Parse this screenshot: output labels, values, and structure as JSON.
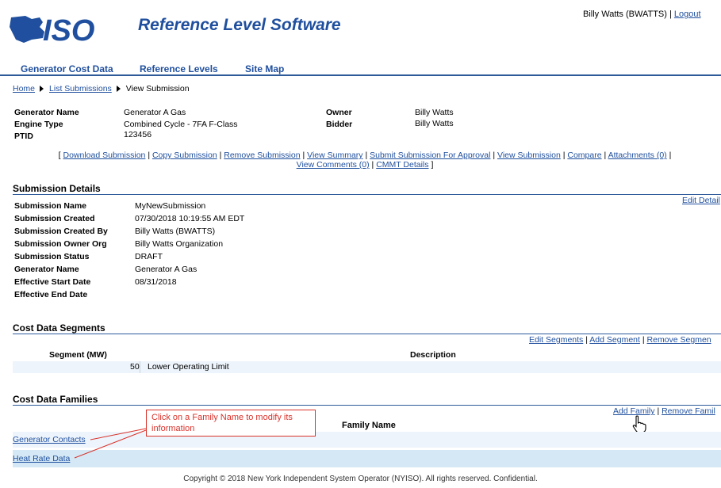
{
  "header": {
    "logo_text": "ISO",
    "app_title": "Reference Level Software",
    "user": "Billy Watts (BWATTS)",
    "separator": "|",
    "logout": "Logout"
  },
  "nav": {
    "items": [
      "Generator Cost Data",
      "Reference Levels",
      "Site Map"
    ]
  },
  "breadcrumb": {
    "home": "Home",
    "list": "List Submissions",
    "current": "View Submission"
  },
  "generator": {
    "name_label": "Generator Name",
    "name": "Generator A Gas",
    "engine_label": "Engine Type",
    "engine": "Combined Cycle - 7FA F-Class",
    "ptid_label": "PTID",
    "ptid": "123456",
    "owner_label": "Owner",
    "owner": "Billy Watts",
    "bidder_label": "Bidder",
    "bidder": "Billy Watts"
  },
  "actions": {
    "open": "[",
    "close": "]",
    "sep": "|",
    "download": "Download Submission",
    "copy": "Copy Submission",
    "remove": "Remove Submission",
    "view_summary": "View Summary",
    "submit": "Submit Submission For Approval",
    "view_submission": "View Submission",
    "compare": "Compare",
    "attachments": "Attachments (0)",
    "view_comments": "View Comments (0)",
    "cmmt": "CMMT Details"
  },
  "submission": {
    "title": "Submission Details",
    "edit": "Edit Detail",
    "fields": [
      {
        "label": "Submission Name",
        "value": "MyNewSubmission"
      },
      {
        "label": "Submission Created",
        "value": "07/30/2018 10:19:55 AM EDT"
      },
      {
        "label": "Submission Created By",
        "value": "Billy Watts (BWATTS)"
      },
      {
        "label": "Submission Owner Org",
        "value": "Billy Watts Organization"
      },
      {
        "label": "Submission Status",
        "value": "DRAFT"
      },
      {
        "label": "Generator Name",
        "value": "Generator A Gas"
      },
      {
        "label": "Effective Start Date",
        "value": "08/31/2018"
      },
      {
        "label": "Effective End Date",
        "value": ""
      }
    ]
  },
  "segments": {
    "title": "Cost Data Segments",
    "edit": "Edit Segments",
    "add": "Add Segment",
    "remove": "Remove Segmen",
    "sep": "|",
    "col_segment": "Segment (MW)",
    "col_description": "Description",
    "rows": [
      {
        "mw": "50",
        "description": "Lower Operating Limit"
      }
    ]
  },
  "families": {
    "title": "Cost Data Families",
    "add": "Add Family",
    "remove": "Remove Famil",
    "sep": "|",
    "col_name": "Family Name",
    "rows": [
      "Generator Contacts",
      "Heat Rate Data"
    ],
    "callout": "Click on a Family Name to modify its information"
  },
  "footer": "Copyright © 2018 New York Independent System Operator (NYISO). All rights reserved. Confidential.",
  "colors": {
    "brand": "#1f4f9e",
    "rule": "#2e5a9a",
    "row_stripe": "#edf4fb",
    "row_blue": "#d4e9f5",
    "callout": "#d9322b"
  }
}
